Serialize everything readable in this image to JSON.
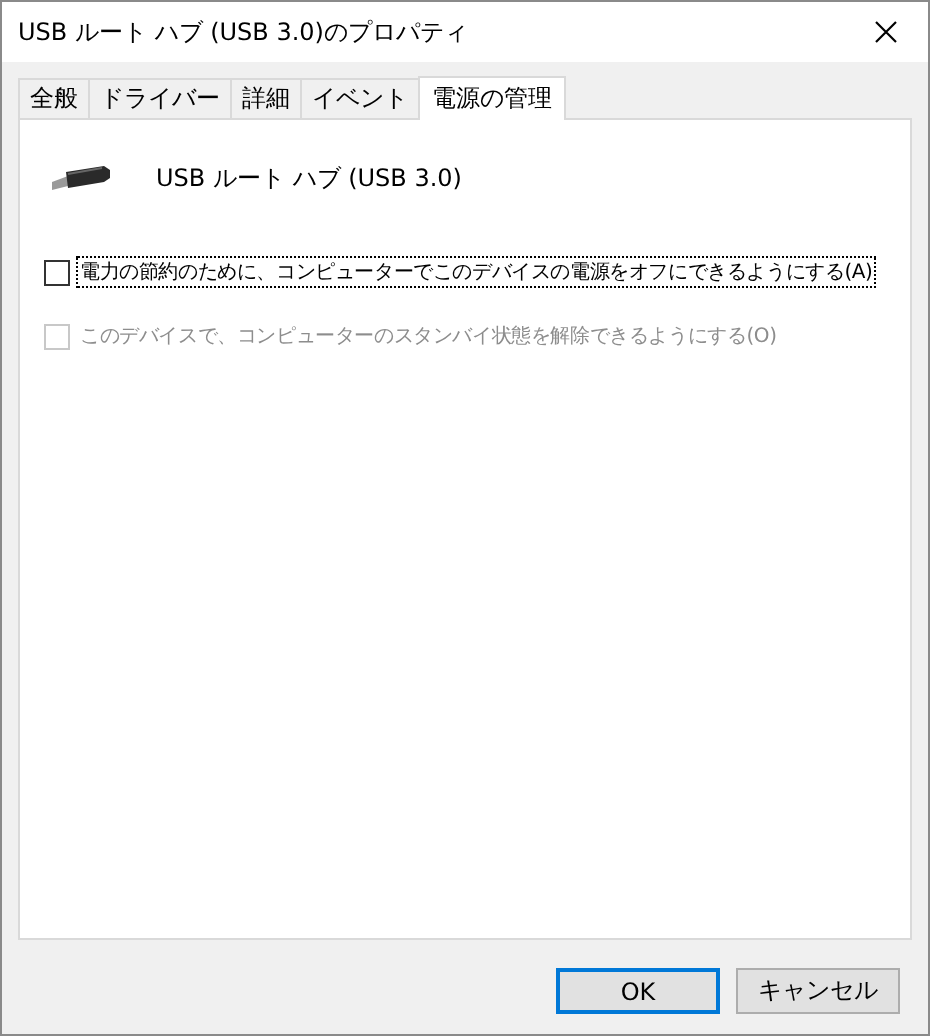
{
  "window": {
    "title": "USB ルート ハブ (USB 3.0)のプロパティ"
  },
  "tabs": [
    {
      "label": "全般",
      "selected": false
    },
    {
      "label": "ドライバー",
      "selected": false
    },
    {
      "label": "詳細",
      "selected": false
    },
    {
      "label": "イベント",
      "selected": false
    },
    {
      "label": "電源の管理",
      "selected": true
    }
  ],
  "device": {
    "name": "USB ルート ハブ (USB 3.0)"
  },
  "options": [
    {
      "label": "電力の節約のために、コンピューターでこのデバイスの電源をオフにできるようにする(A)",
      "checked": false,
      "disabled": false,
      "focused": true
    },
    {
      "label": "このデバイスで、コンピューターのスタンバイ状態を解除できるようにする(O)",
      "checked": false,
      "disabled": true,
      "focused": false
    }
  ],
  "buttons": [
    {
      "label": "OK",
      "default": true
    },
    {
      "label": "キャンセル",
      "default": false
    }
  ]
}
